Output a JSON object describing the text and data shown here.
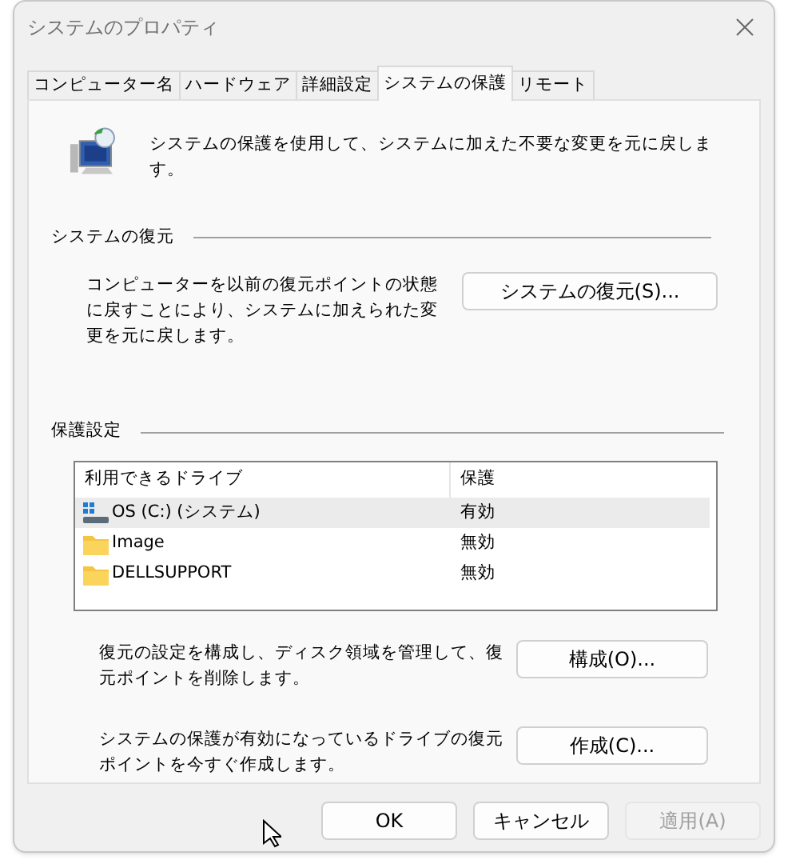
{
  "window": {
    "title": "システムのプロパティ"
  },
  "tabs": [
    {
      "label": "コンピューター名",
      "selected": false
    },
    {
      "label": "ハードウェア",
      "selected": false
    },
    {
      "label": "詳細設定",
      "selected": false
    },
    {
      "label": "システムの保護",
      "selected": true
    },
    {
      "label": "リモート",
      "selected": false
    }
  ],
  "intro": "システムの保護を使用して、システムに加えた不要な変更を元に戻します。",
  "restore": {
    "heading": "システムの復元",
    "description": "コンピューターを以前の復元ポイントの状態に戻すことにより、システムに加えられた変更を元に戻します。",
    "button": "システムの復元(S)..."
  },
  "protection": {
    "heading": "保護設定",
    "columns": [
      "利用できるドライブ",
      "保護"
    ],
    "rows": [
      {
        "kind": "system",
        "name": "OS (C:) (システム)",
        "status": "有効",
        "selected": true
      },
      {
        "kind": "folder",
        "name": "Image",
        "status": "無効",
        "selected": false
      },
      {
        "kind": "folder",
        "name": "DELLSUPPORT",
        "status": "無効",
        "selected": false
      }
    ],
    "actions": [
      {
        "description": "復元の設定を構成し、ディスク領域を管理して、復元ポイントを削除します。",
        "button": "構成(O)..."
      },
      {
        "description": "システムの保護が有効になっているドライブの復元ポイントを今すぐ作成します。",
        "button": "作成(C)..."
      }
    ]
  },
  "buttons": [
    {
      "label": "OK",
      "disabled": false
    },
    {
      "label": "キャンセル",
      "disabled": false
    },
    {
      "label": "適用(A)",
      "disabled": true
    }
  ]
}
